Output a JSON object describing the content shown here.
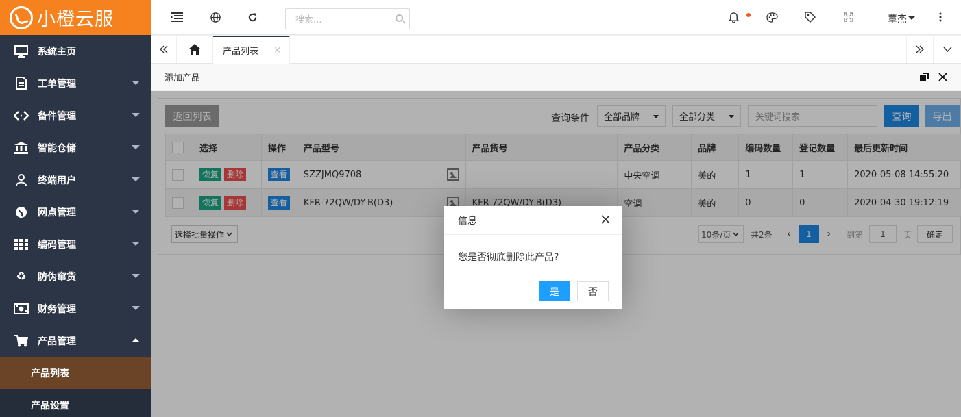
{
  "app": {
    "logo_text": "小橙云服"
  },
  "sidebar": {
    "items": [
      {
        "label": "系统主页",
        "icon": "monitor-icon"
      },
      {
        "label": "工单管理",
        "icon": "document-icon"
      },
      {
        "label": "备件管理",
        "icon": "code-icon"
      },
      {
        "label": "智能仓储",
        "icon": "bank-icon"
      },
      {
        "label": "终端用户",
        "icon": "user-icon"
      },
      {
        "label": "网点管理",
        "icon": "globe-icon"
      },
      {
        "label": "编码管理",
        "icon": "grid-icon"
      },
      {
        "label": "防伪窜货",
        "icon": "recycle-icon"
      },
      {
        "label": "财务管理",
        "icon": "money-icon"
      },
      {
        "label": "产品管理",
        "icon": "cart-icon"
      }
    ],
    "sub_items": [
      {
        "label": "产品列表"
      },
      {
        "label": "产品设置"
      }
    ]
  },
  "header": {
    "search_placeholder": "搜索...",
    "user_name": "覃杰"
  },
  "tabs": {
    "active_label": "产品列表",
    "close_glyph": "×"
  },
  "subheader": {
    "title": "添加产品"
  },
  "toolbar": {
    "back_label": "返回列表",
    "filter_label": "查询条件",
    "brand_select": "全部品牌",
    "category_select": "全部分类",
    "keyword_placeholder": "关键词搜索",
    "query_label": "查询",
    "export_label": "导出"
  },
  "table": {
    "columns": [
      "选择",
      "操作",
      "产品型号",
      "产品货号",
      "产品分类",
      "品牌",
      "编码数量",
      "登记数量",
      "最后更新时间"
    ],
    "restore_label": "恢复",
    "delete_label": "删除",
    "view_label": "查看",
    "rows": [
      {
        "model": "SZZJMQ9708",
        "sku": "",
        "category": "中央空调",
        "brand": "美的",
        "code_count": "1",
        "reg_count": "1",
        "updated": "2020-05-08 14:55:20"
      },
      {
        "model": "KFR-72QW/DY-B(D3)",
        "sku": "KFR-72QW/DY-B(D3)",
        "category": "空调",
        "brand": "美的",
        "code_count": "0",
        "reg_count": "0",
        "updated": "2020-04-30 19:12:19"
      }
    ]
  },
  "pager": {
    "batch_select": "选择批量操作",
    "page_size": "10条/页",
    "total": "共2条",
    "current_page": "1",
    "goto_label": "到第",
    "goto_value": "1",
    "page_unit": "页",
    "confirm_label": "确定"
  },
  "dialog": {
    "title": "信息",
    "message": "您是否彻底删除此产品?",
    "yes_label": "是",
    "no_label": "否"
  },
  "colors": {
    "logo_bg": "#f5821f",
    "sidebar_bg": "#2c3546",
    "active_sub_bg": "#6b4428",
    "primary": "#1e88e5",
    "dialog_yes": "#1e9fff",
    "restore": "#1ba784",
    "delete": "#f0504f"
  }
}
